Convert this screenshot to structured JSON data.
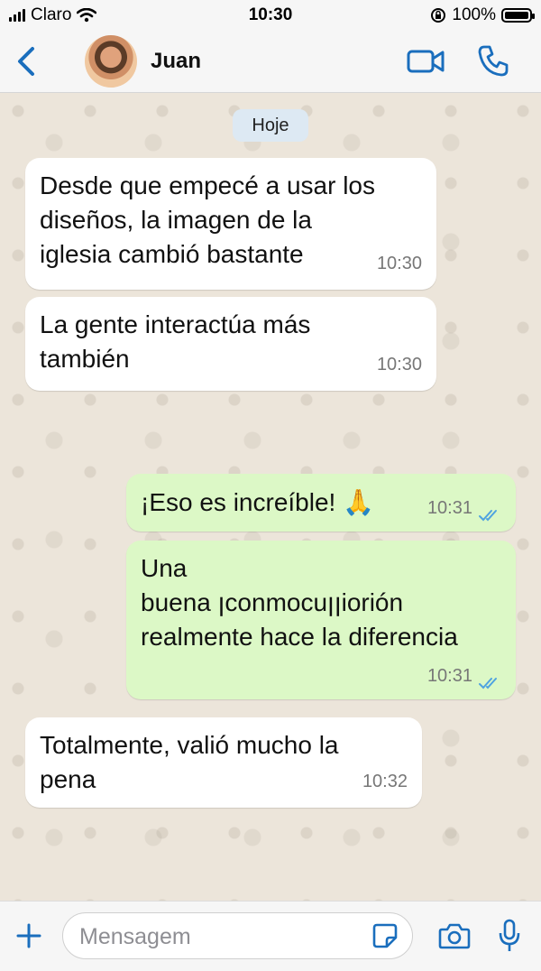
{
  "status_bar": {
    "carrier": "Claro",
    "time": "10:30",
    "battery": "100%"
  },
  "header": {
    "contact_name": "Juan"
  },
  "chat": {
    "date_label": "Hoje",
    "messages": [
      {
        "direction": "in",
        "lines": [
          "Desde que empecé a usar los",
          "diseños, la imagen de la",
          "iglesia cambió bastante"
        ],
        "time": "10:30"
      },
      {
        "direction": "in",
        "lines": [
          "La gente interactúa más",
          "también"
        ],
        "time": "10:30"
      },
      {
        "direction": "out",
        "lines": [
          "¡Eso es increíble! 🙏"
        ],
        "time": "10:31",
        "status": "read"
      },
      {
        "direction": "out",
        "lines": [
          "Una",
          "buena ꞁconmocuꞁꞁiorión",
          "realmente hace la diferencia"
        ],
        "time": "10:31",
        "status": "read"
      },
      {
        "direction": "in",
        "lines": [
          "Totalmente, valió mucho la",
          "pena"
        ],
        "time": "10:32"
      }
    ]
  },
  "composer": {
    "placeholder": "Mensagem"
  },
  "colors": {
    "accent": "#1a6ebd",
    "outgoing_bubble": "#dcf8c6",
    "incoming_bubble": "#ffffff",
    "read_ticks": "#4fa3e0"
  },
  "icons": [
    "signal-icon",
    "wifi-icon",
    "lock-rotation-icon",
    "battery-icon",
    "back-icon",
    "video-call-icon",
    "phone-icon",
    "plus-icon",
    "sticker-icon",
    "camera-icon",
    "microphone-icon"
  ]
}
